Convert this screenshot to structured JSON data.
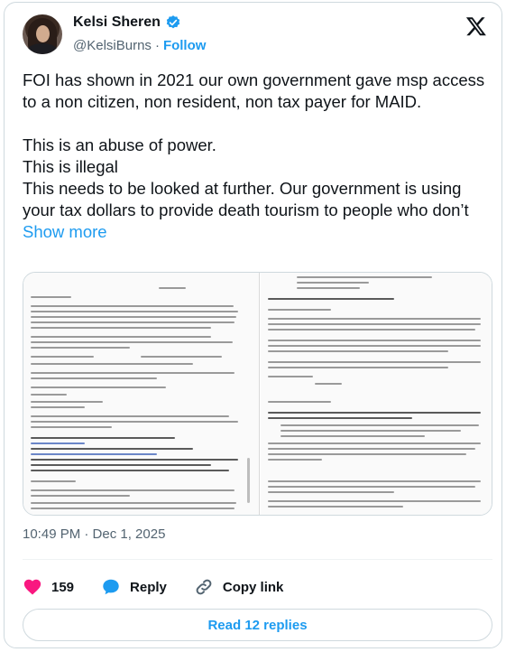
{
  "author": {
    "display_name": "Kelsi Sheren",
    "handle": "@KelsiBurns",
    "separator": "·",
    "follow_label": "Follow"
  },
  "tweet": {
    "text": "FOI has shown in 2021 our own government gave msp access to a non citizen, non resident, non tax payer for MAID.\n\nThis is an abuse of power.\nThis is illegal\nThis needs to be looked at further. Our government is using your tax dollars to provide death tourism to people who don’t ",
    "show_more_label": "Show more",
    "timestamp": "10:49 PM · Dec 1, 2025"
  },
  "actions": {
    "likes_count": "159",
    "reply_label": "Reply",
    "copy_link_label": "Copy link"
  },
  "read_replies_label": "Read 12 replies",
  "colors": {
    "accent": "#1d9bf0",
    "like": "#f91880",
    "text": "#0f1419",
    "muted": "#536471"
  },
  "icons": [
    "verified-badge-icon",
    "x-logo-icon",
    "heart-icon",
    "reply-bubble-icon",
    "link-icon"
  ]
}
